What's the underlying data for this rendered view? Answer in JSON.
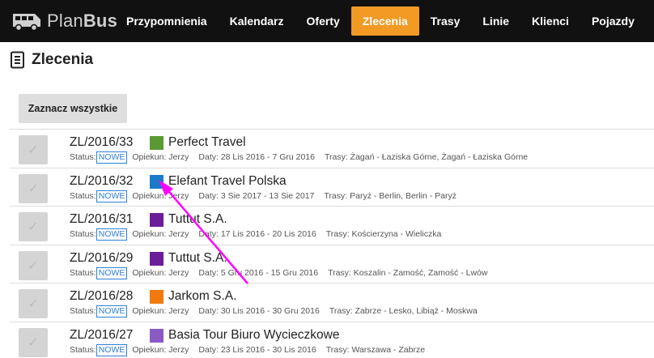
{
  "app": {
    "name_plain": "Plan",
    "name_bold": "Bus"
  },
  "nav": [
    {
      "label": "Przypomnienia"
    },
    {
      "label": "Kalendarz"
    },
    {
      "label": "Oferty"
    },
    {
      "label": "Zlecenia"
    },
    {
      "label": "Trasy"
    },
    {
      "label": "Linie"
    },
    {
      "label": "Klienci"
    },
    {
      "label": "Pojazdy"
    }
  ],
  "nav_active_index": 3,
  "page": {
    "title": "Zlecenia"
  },
  "toolbar": {
    "select_all_label": "Zaznacz wszystkie"
  },
  "colors": {
    "accent": "#f39a24",
    "topbar": "#111111",
    "badge": "#2f7fd6",
    "arrow": "#ff00ff"
  },
  "orders": [
    {
      "code": "ZL/2016/33",
      "color": "#5a9a33",
      "client": "Perfect Travel",
      "status_label": "Status:",
      "status": "NOWE",
      "keeper": "Opiekun: Jerzy",
      "dates": "Daty: 28 Lis 2016 - 7 Gru 2016",
      "routes": "Trasy: Żagań - Łaziska Górne, Żagań - Łaziska Górne"
    },
    {
      "code": "ZL/2016/32",
      "color": "#1a7bc9",
      "client": "Elefant Travel Polska",
      "status_label": "Status:",
      "status": "NOWE",
      "keeper": "Opiekun: Jerzy",
      "dates": "Daty: 3 Sie 2017 - 13 Sie 2017",
      "routes": "Trasy: Paryż - Berlin, Berlin - Paryż"
    },
    {
      "code": "ZL/2016/31",
      "color": "#6c1d99",
      "client": "Tuttut S.A.",
      "status_label": "Status:",
      "status": "NOWE",
      "keeper": "Opiekun: Jerzy",
      "dates": "Daty: 17 Lis 2016 - 20 Lis 2016",
      "routes": "Trasy: Kościerzyna - Wieliczka"
    },
    {
      "code": "ZL/2016/29",
      "color": "#6c1d99",
      "client": "Tuttut S.A.",
      "status_label": "Status:",
      "status": "NOWE",
      "keeper": "Opiekun: Jerzy",
      "dates": "Daty: 5 Gru 2016 - 15 Gru 2016",
      "routes": "Trasy: Koszalin - Zamość, Zamość - Lwów"
    },
    {
      "code": "ZL/2016/28",
      "color": "#f07a10",
      "client": "Jarkom S.A.",
      "status_label": "Status:",
      "status": "NOWE",
      "keeper": "Opiekun: Jerzy",
      "dates": "Daty: 30 Lis 2016 - 30 Gru 2016",
      "routes": "Trasy: Zabrze - Lesko, Libiąż - Moskwa"
    },
    {
      "code": "ZL/2016/27",
      "color": "#8a5ac4",
      "client": "Basia Tour Biuro Wycieczkowe",
      "status_label": "Status:",
      "status": "NOWE",
      "keeper": "Opiekun: Jerzy",
      "dates": "Daty: 23 Lis 2016 - 30 Lis 2016",
      "routes": "Trasy: Warszawa - Zabrze"
    }
  ]
}
